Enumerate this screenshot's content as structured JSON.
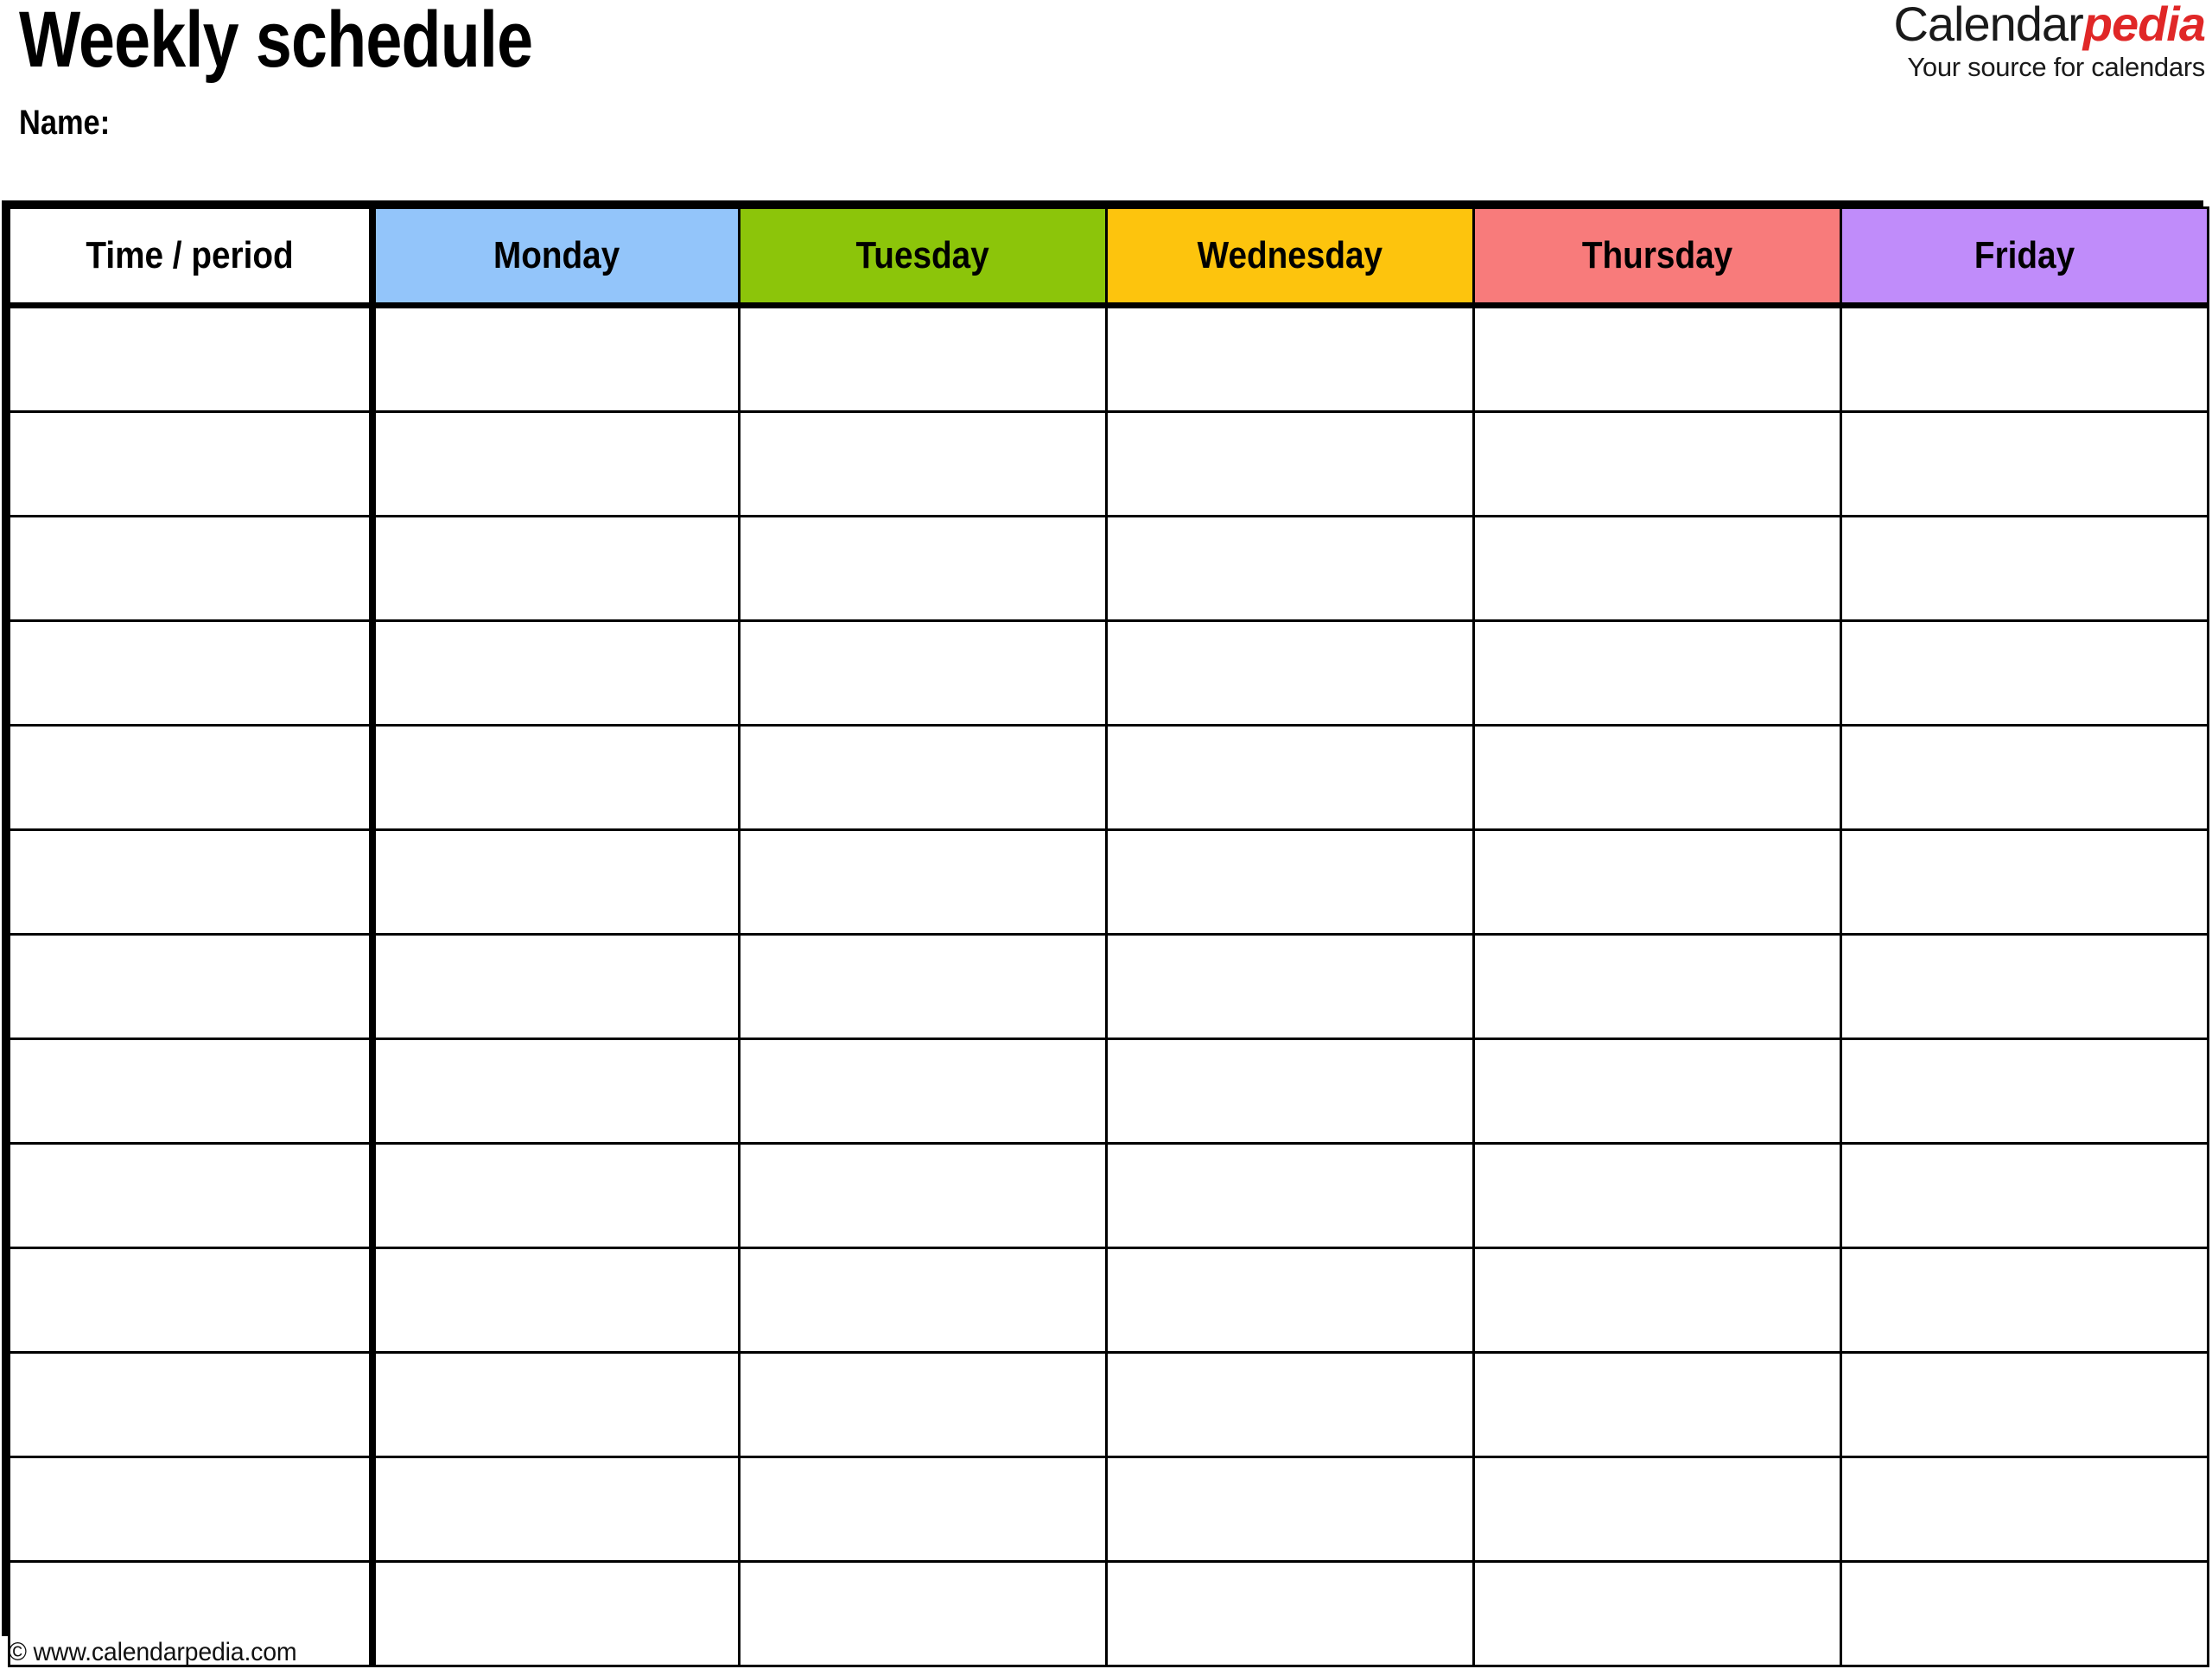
{
  "document": {
    "title": "Weekly schedule",
    "name_label": "Name:"
  },
  "logo": {
    "word_primary": "Calendar",
    "word_accent": "pedia",
    "tagline": "Your source for calendars",
    "accent_color": "#e02727",
    "primary_color": "#1a1a1a"
  },
  "table": {
    "columns": [
      {
        "label": "Time / period",
        "bg": "#ffffff",
        "key": "time"
      },
      {
        "label": "Monday",
        "bg": "#93c5fa",
        "key": "monday"
      },
      {
        "label": "Tuesday",
        "bg": "#8cc50a",
        "key": "tuesday"
      },
      {
        "label": "Wednesday",
        "bg": "#fdc40d",
        "key": "wednesday"
      },
      {
        "label": "Thursday",
        "bg": "#f87b7b",
        "key": "thursday"
      },
      {
        "label": "Friday",
        "bg": "#c08cfa",
        "key": "friday"
      }
    ],
    "row_count": 13,
    "rows": [
      {
        "time": "",
        "monday": "",
        "tuesday": "",
        "wednesday": "",
        "thursday": "",
        "friday": ""
      },
      {
        "time": "",
        "monday": "",
        "tuesday": "",
        "wednesday": "",
        "thursday": "",
        "friday": ""
      },
      {
        "time": "",
        "monday": "",
        "tuesday": "",
        "wednesday": "",
        "thursday": "",
        "friday": ""
      },
      {
        "time": "",
        "monday": "",
        "tuesday": "",
        "wednesday": "",
        "thursday": "",
        "friday": ""
      },
      {
        "time": "",
        "monday": "",
        "tuesday": "",
        "wednesday": "",
        "thursday": "",
        "friday": ""
      },
      {
        "time": "",
        "monday": "",
        "tuesday": "",
        "wednesday": "",
        "thursday": "",
        "friday": ""
      },
      {
        "time": "",
        "monday": "",
        "tuesday": "",
        "wednesday": "",
        "thursday": "",
        "friday": ""
      },
      {
        "time": "",
        "monday": "",
        "tuesday": "",
        "wednesday": "",
        "thursday": "",
        "friday": ""
      },
      {
        "time": "",
        "monday": "",
        "tuesday": "",
        "wednesday": "",
        "thursday": "",
        "friday": ""
      },
      {
        "time": "",
        "monday": "",
        "tuesday": "",
        "wednesday": "",
        "thursday": "",
        "friday": ""
      },
      {
        "time": "",
        "monday": "",
        "tuesday": "",
        "wednesday": "",
        "thursday": "",
        "friday": ""
      },
      {
        "time": "",
        "monday": "",
        "tuesday": "",
        "wednesday": "",
        "thursday": "",
        "friday": ""
      },
      {
        "time": "",
        "monday": "",
        "tuesday": "",
        "wednesday": "",
        "thursday": "",
        "friday": ""
      }
    ]
  },
  "footer": {
    "copyright": "© www.calendarpedia.com"
  }
}
